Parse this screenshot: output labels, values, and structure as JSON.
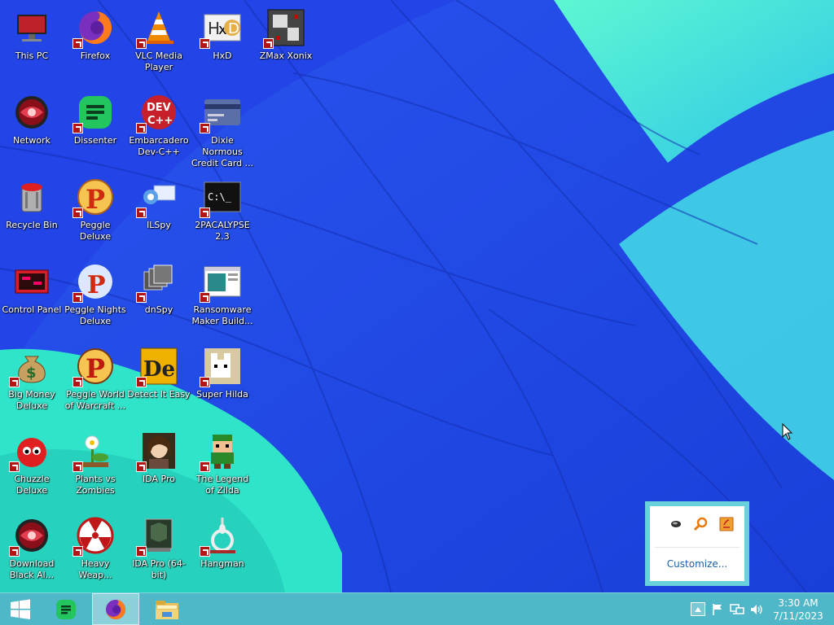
{
  "desktop_icons": [
    {
      "label": "This PC",
      "icon": "computer-icon"
    },
    {
      "label": "Firefox",
      "icon": "firefox-icon"
    },
    {
      "label": "VLC Media Player",
      "icon": "vlc-cone-icon"
    },
    {
      "label": "HxD",
      "icon": "hxd-icon"
    },
    {
      "label": "ZMax Xonix",
      "icon": "xonix-icon"
    },
    {
      "label": "Network",
      "icon": "network-orb-icon"
    },
    {
      "label": "Dissenter",
      "icon": "dissenter-icon"
    },
    {
      "label": "Embarcadero Dev-C++",
      "icon": "devcpp-icon"
    },
    {
      "label": "Dixie Normous Credit Card ...",
      "icon": "credit-card-icon"
    },
    {
      "label": "Recycle Bin",
      "icon": "recycle-bin-icon"
    },
    {
      "label": "Peggle Deluxe",
      "icon": "peggle-icon"
    },
    {
      "label": "ILSpy",
      "icon": "ilspy-icon"
    },
    {
      "label": "2PACALYPSE 2.3",
      "icon": "terminal-icon"
    },
    {
      "label": "Control Panel",
      "icon": "control-panel-icon"
    },
    {
      "label": "Peggle Nights Deluxe",
      "icon": "peggle-nights-icon"
    },
    {
      "label": "dnSpy",
      "icon": "dnspy-icon"
    },
    {
      "label": "Ransomware Maker Build...",
      "icon": "window-app-icon"
    },
    {
      "label": "Big Money Deluxe",
      "icon": "money-bag-icon"
    },
    {
      "label": "Peggle World of Warcraft ...",
      "icon": "peggle-wow-icon"
    },
    {
      "label": "Detect It Easy",
      "icon": "die-icon"
    },
    {
      "label": "Super Hilda",
      "icon": "pixel-cat-icon"
    },
    {
      "label": "Chuzzle Deluxe",
      "icon": "chuzzle-icon"
    },
    {
      "label": "Plants vs Zombies",
      "icon": "flower-icon"
    },
    {
      "label": "IDA Pro",
      "icon": "ida-portrait-icon"
    },
    {
      "label": "The Legend of Zilda",
      "icon": "pixel-hero-icon"
    },
    {
      "label": "Download Black Al...",
      "icon": "download-orb-icon"
    },
    {
      "label": "Heavy Weap...",
      "icon": "radiation-icon"
    },
    {
      "label": "IDA Pro (64-bit)",
      "icon": "ida64-icon"
    },
    {
      "label": "Hangman",
      "icon": "noose-icon"
    }
  ],
  "taskbar": {
    "start_icon": "windows-logo-icon",
    "pinned": [
      {
        "name": "Dissenter",
        "icon": "dissenter-icon",
        "active": false
      },
      {
        "name": "Firefox",
        "icon": "firefox-icon",
        "active": true
      },
      {
        "name": "File Explorer",
        "icon": "folder-icon",
        "active": false
      }
    ],
    "tray_icons": [
      "chevron-up-icon",
      "flag-icon",
      "network-icon",
      "volume-icon"
    ],
    "clock": {
      "time": "3:30 AM",
      "date": "7/11/2023"
    }
  },
  "tray_popup": {
    "icons": [
      "usb-device-icon",
      "search-tool-icon",
      "java-icon"
    ],
    "customize_label": "Customize..."
  },
  "colors": {
    "taskbar": "#4fb7c7",
    "wallpaper_blue": "#1d46e8",
    "wallpaper_cyan": "#47f0d8",
    "link": "#1a5fa8"
  }
}
